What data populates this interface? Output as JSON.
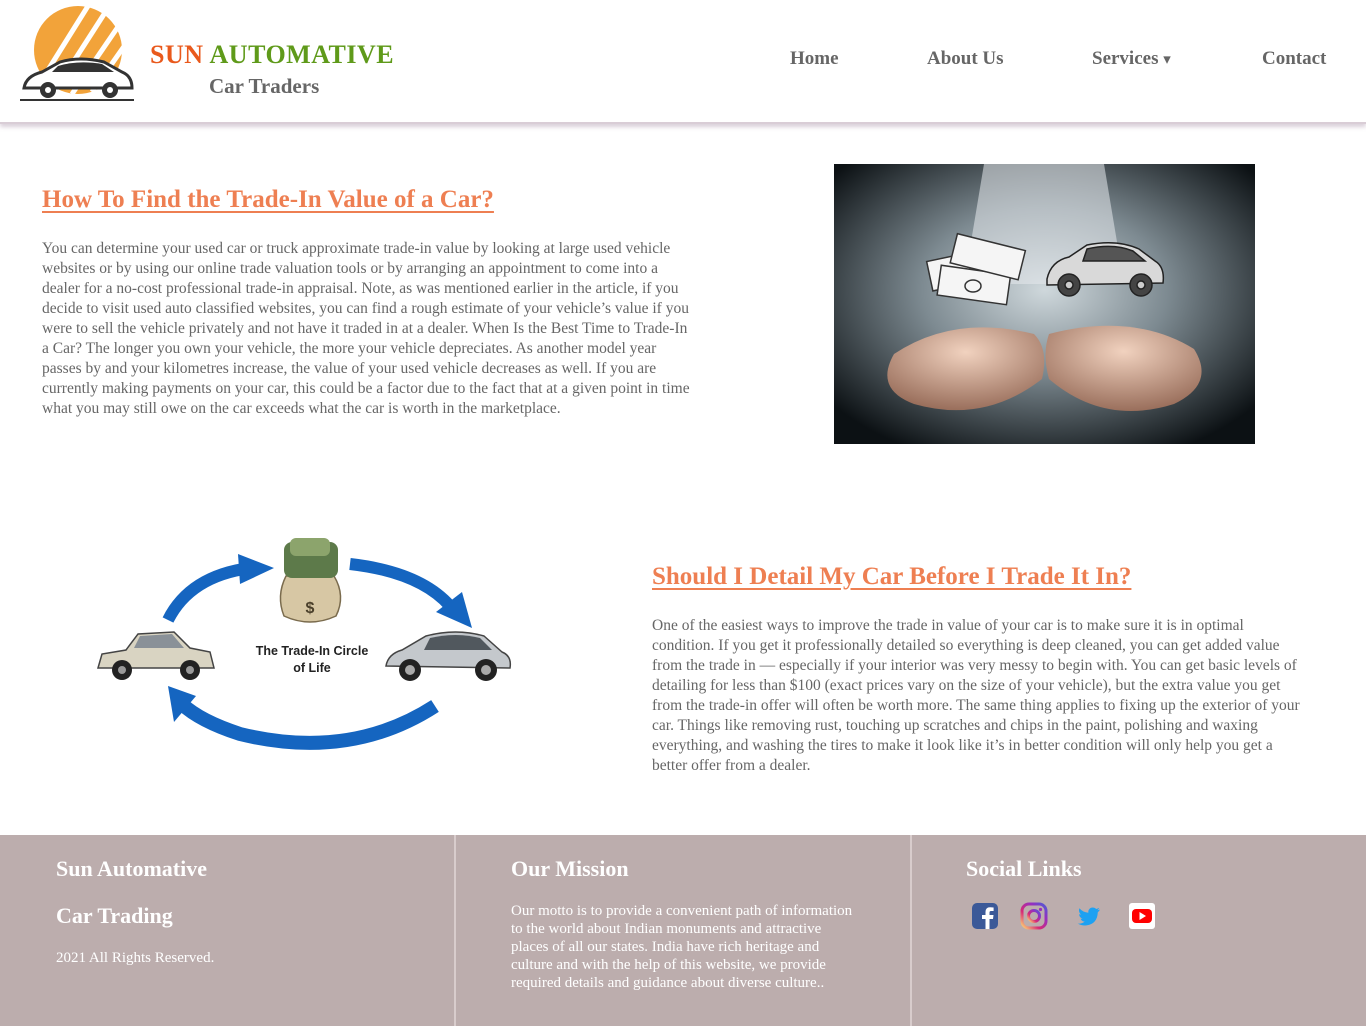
{
  "header": {
    "brand_word1": "SUN",
    "brand_word2": "AUTOMATIVE",
    "brand_sub": "Car Traders",
    "nav": {
      "home": "Home",
      "about": "About Us",
      "services": "Services",
      "services_caret": "▾",
      "contact": "Contact"
    }
  },
  "section1": {
    "title": "How To Find the Trade-In Value of a Car?",
    "body": "You can determine your used car or truck approximate trade-in value by looking at large used vehicle websites or by using our online trade valuation tools or by arranging an appointment to come into a dealer for a no-cost professional trade-in appraisal. Note, as was mentioned earlier in the article, if you decide to visit used auto classified websites, you can find a rough estimate of your vehicle’s value if you were to sell the vehicle privately and not have it traded in at a dealer. When Is the Best Time to Trade-In a Car? The longer you own your vehicle, the more your vehicle depreciates. As another model year passes by and your kilometres increase, the value of your used vehicle decreases as well. If you are currently making payments on your car, this could be a factor due to the fact that at a given point in time what you may still owe on the car exceeds what the car is worth in the marketplace."
  },
  "section2": {
    "title": "Should I Detail My Car Before I Trade It In?",
    "body": "One of the easiest ways to improve the trade in value of your car is to make sure it is in optimal condition. If you get it professionally detailed so everything is deep cleaned, you can get added value from the trade in — especially if your interior was very messy to begin with. You can get basic levels of detailing for less than $100 (exact prices vary on the size of your vehicle), but the extra value you get from the trade-in offer will often be worth more. The same thing applies to fixing up the exterior of your car. Things like removing rust, touching up scratches and chips in the paint, polishing and waxing everything, and washing the tires to make it look like it’s in better condition will only help you get a better offer from a dealer.",
    "diagram_caption_line1": "The Trade-In Circle",
    "diagram_caption_line2": "of Life",
    "money_symbol": "$"
  },
  "footer": {
    "col1_line1": "Sun Automative",
    "col1_line2": "Car Trading",
    "copyright": "2021 All Rights Reserved.",
    "mission_title": "Our Mission",
    "mission_body": "Our motto is to provide a convenient path of information to the world about Indian monuments and attractive places of all our states. India have rich heritage and culture and with the help of this website, we provide required details and guidance about diverse culture..",
    "social_title": "Social Links",
    "social_icons": [
      "facebook-icon",
      "instagram-icon",
      "twitter-icon",
      "youtube-icon"
    ]
  },
  "colors": {
    "accent_orange": "#ee7f52",
    "brand_green": "#5f9a1a",
    "brand_red": "#e9591c",
    "footer_bg": "#bcadad",
    "arrow_blue": "#1565c0"
  }
}
